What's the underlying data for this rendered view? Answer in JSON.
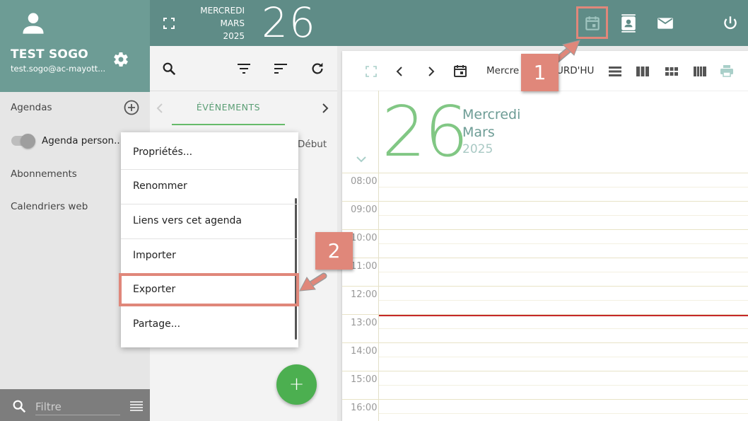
{
  "sidebar": {
    "user_name": "TEST SOGO",
    "user_email": "test.sogo@ac-mayott...",
    "sections": {
      "agendas": "Agendas",
      "agenda_personnel": "Agenda person...",
      "abonnements": "Abonnements",
      "calendriers_web": "Calendriers web"
    },
    "filter_placeholder": "Filtre"
  },
  "header": {
    "weekday": "MERCREDI",
    "month": "MARS",
    "year": "2025",
    "day": "26"
  },
  "list": {
    "tab_label": "ÉVÉNEMENTS",
    "column_debut": "Début",
    "fab_label": "+"
  },
  "context_menu": {
    "items": [
      "Propriétés...",
      "Renommer",
      "Liens vers cet agenda",
      "Importer",
      "Exporter",
      "Partage..."
    ]
  },
  "calendar": {
    "toolbar_date": "Mercre",
    "toolbar_today": "URD'HU",
    "day_number": "26",
    "weekday": "Mercredi",
    "month": "Mars",
    "year": "2025",
    "hours": [
      "08:00",
      "09:00",
      "10:00",
      "11:00",
      "12:00",
      "13:00",
      "14:00",
      "15:00",
      "16:00"
    ]
  },
  "callouts": {
    "one": "1",
    "two": "2"
  },
  "colors": {
    "header_teal": "#5f8c87",
    "user_box_teal": "#6d9c95",
    "accent_green": "#4caf50",
    "callout_salmon": "#e0877a",
    "now_line_red": "#c62828"
  },
  "icons": [
    "person-icon",
    "gear-icon",
    "add-circle-icon",
    "search-icon",
    "menu-icon",
    "fullscreen-icon",
    "calendar-icon",
    "contacts-icon",
    "mail-icon",
    "power-icon",
    "filter-icon",
    "sort-icon",
    "refresh-icon",
    "chevron-left-icon",
    "chevron-right-icon",
    "view-day-icon",
    "view-week-icon",
    "view-month-icon",
    "view-multicolumn-icon",
    "print-icon",
    "chevron-down-icon"
  ]
}
